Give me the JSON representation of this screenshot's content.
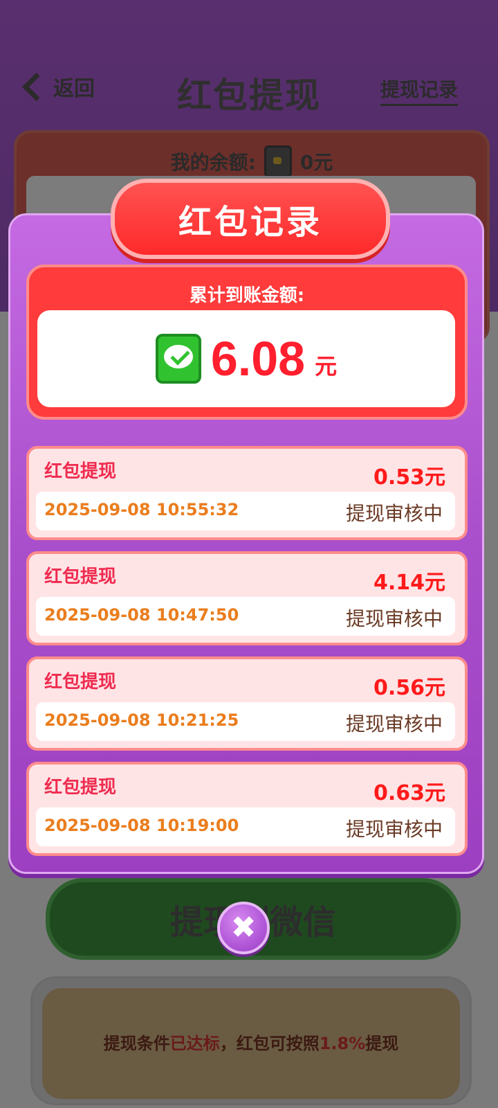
{
  "background": {
    "header": {
      "back_label": "返回",
      "title": "红包提现",
      "history_link": "提现记录"
    },
    "balance": {
      "label": "我的余额:",
      "value": "0元"
    },
    "withdraw_button": "提现到微信",
    "condition": {
      "prefix": "提现条件",
      "highlight": "已达标",
      "middle": "，红包可按照",
      "percent": "1.8%",
      "suffix": "提现"
    }
  },
  "modal": {
    "title": "红包记录",
    "total_label": "累计到账金额:",
    "total_amount": "6.08",
    "total_unit": "元",
    "records": [
      {
        "name": "红包提现",
        "amount": "0.53元",
        "time": "2025-09-08 10:55:32",
        "status": "提现审核中"
      },
      {
        "name": "红包提现",
        "amount": "4.14元",
        "time": "2025-09-08 10:47:50",
        "status": "提现审核中"
      },
      {
        "name": "红包提现",
        "amount": "0.56元",
        "time": "2025-09-08 10:21:25",
        "status": "提现审核中"
      },
      {
        "name": "红包提现",
        "amount": "0.63元",
        "time": "2025-09-08 10:19:00",
        "status": "提现审核中"
      }
    ],
    "close_label": "✖"
  }
}
